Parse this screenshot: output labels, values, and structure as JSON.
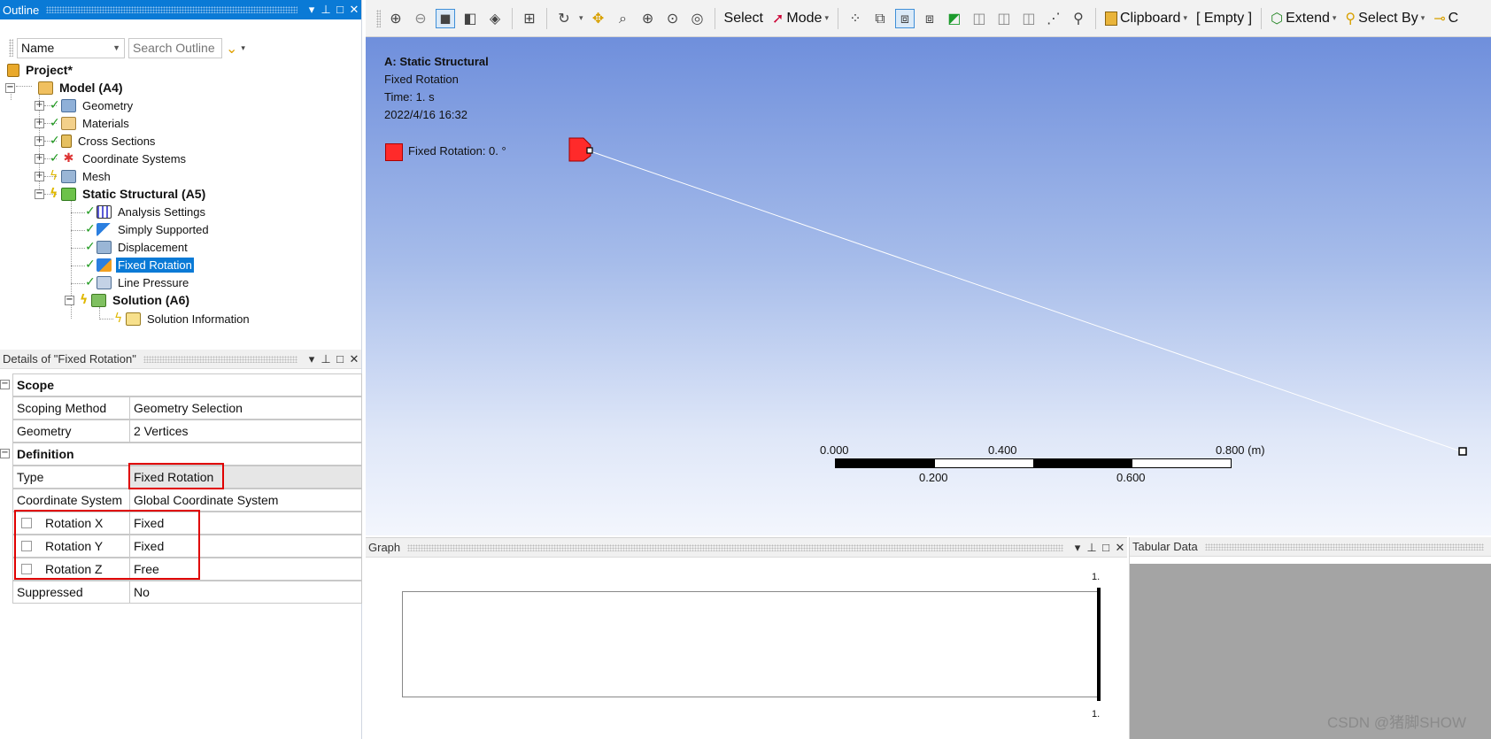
{
  "outline": {
    "title": "Outline",
    "filter_label": "Name",
    "search_placeholder": "Search Outline",
    "tree": {
      "project": "Project*",
      "model": "Model (A4)",
      "geometry": "Geometry",
      "materials": "Materials",
      "cross_sections": "Cross Sections",
      "coordinate_systems": "Coordinate Systems",
      "mesh": "Mesh",
      "static_structural": "Static Structural (A5)",
      "analysis_settings": "Analysis Settings",
      "simply_supported": "Simply Supported",
      "displacement": "Displacement",
      "fixed_rotation": "Fixed Rotation",
      "line_pressure": "Line Pressure",
      "solution": "Solution (A6)",
      "solution_information": "Solution Information"
    }
  },
  "details": {
    "title": "Details of \"Fixed Rotation\"",
    "sections": {
      "scope": "Scope",
      "definition": "Definition"
    },
    "rows": {
      "scoping_method": {
        "label": "Scoping Method",
        "value": "Geometry Selection"
      },
      "geometry": {
        "label": "Geometry",
        "value": "2 Vertices"
      },
      "type": {
        "label": "Type",
        "value": "Fixed Rotation"
      },
      "coordinate_system": {
        "label": "Coordinate System",
        "value": "Global Coordinate System"
      },
      "rotation_x": {
        "label": "Rotation X",
        "value": "Fixed"
      },
      "rotation_y": {
        "label": "Rotation Y",
        "value": "Fixed"
      },
      "rotation_z": {
        "label": "Rotation Z",
        "value": "Free"
      },
      "suppressed": {
        "label": "Suppressed",
        "value": "No"
      }
    }
  },
  "toolbar": {
    "select": "Select",
    "mode": "Mode",
    "clipboard": "Clipboard",
    "empty": "[ Empty ]",
    "extend": "Extend",
    "select_by": "Select By",
    "truncated": "C"
  },
  "viewport": {
    "title": "A: Static Structural",
    "subtitle": "Fixed Rotation",
    "time": "Time: 1. s",
    "date": "2022/4/16 16:32",
    "legend": "Fixed Rotation: 0. °",
    "legend_color": "#ff2a2a",
    "scale": {
      "top_labels": [
        "0.000",
        "0.400",
        "0.800 (m)"
      ],
      "bottom_labels": [
        "0.200",
        "0.600"
      ]
    }
  },
  "graph": {
    "title": "Graph",
    "y_top": "1.",
    "y_bottom": "1."
  },
  "tabular": {
    "title": "Tabular Data"
  },
  "watermark": "CSDN @猪脚SHOW",
  "colors": {
    "accent": "#0a7ad6",
    "highlight": "#e00000",
    "status_ok": "#1e9a1e",
    "status_pending": "#e0b800"
  }
}
